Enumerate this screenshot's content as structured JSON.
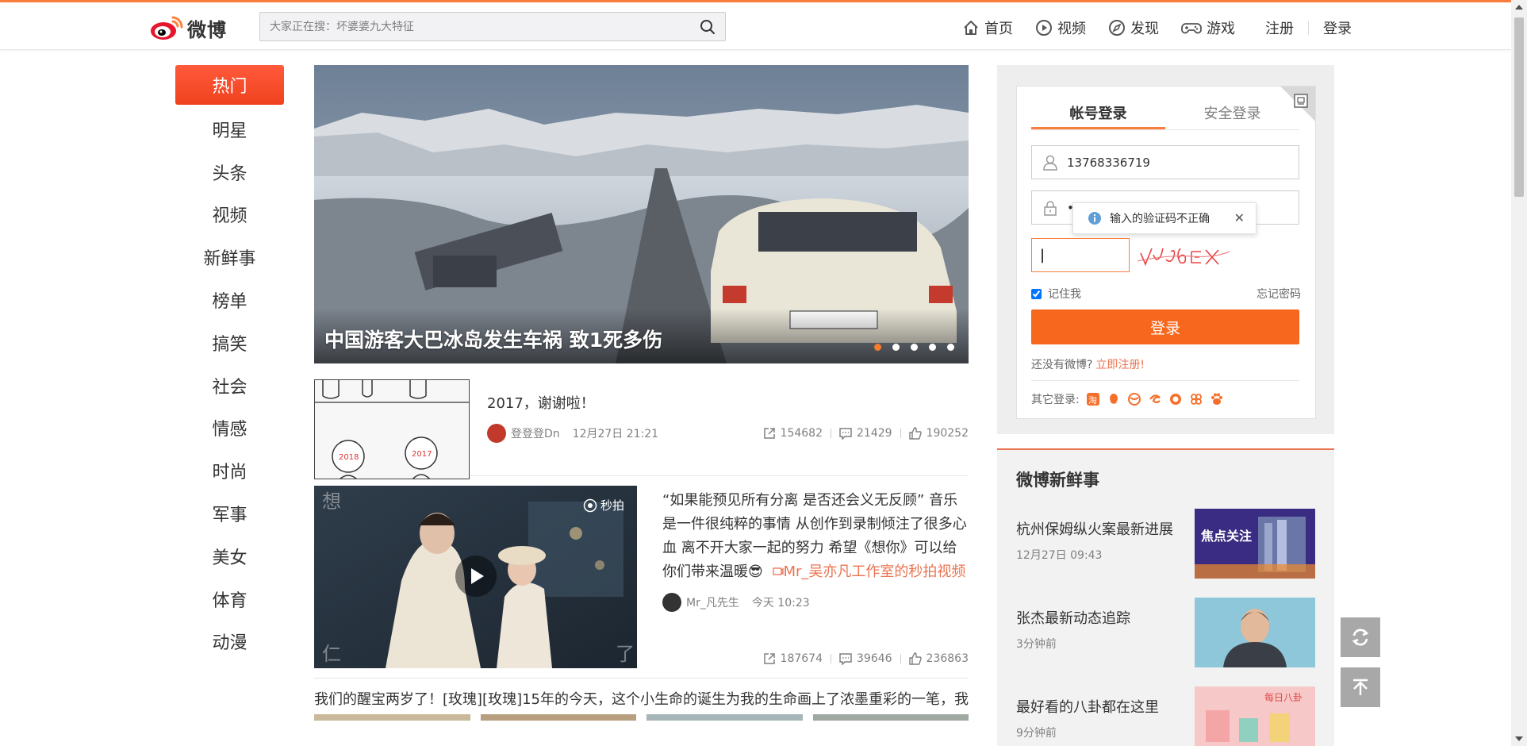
{
  "brand": {
    "name": "微博",
    "accent": "#fa7d3c",
    "link_color": "#eb7350"
  },
  "search": {
    "placeholder": "大家正在搜：坏婆婆九大特征"
  },
  "nav": {
    "home": "首页",
    "video": "视频",
    "discover": "发现",
    "game": "游戏",
    "register": "注册",
    "login": "登录"
  },
  "leftnav": {
    "items": [
      "热门",
      "明星",
      "头条",
      "视频",
      "新鲜事",
      "榜单",
      "搞笑",
      "社会",
      "情感",
      "时尚",
      "军事",
      "美女",
      "体育",
      "动漫"
    ]
  },
  "hero": {
    "title": "中国游客大巴冰岛发生车祸 致1死多伤",
    "slides": 5,
    "active_slide": 1
  },
  "feed": [
    {
      "text": "2017，谢谢啦！",
      "author": "登登登Dn",
      "time": "12月27日 21:21",
      "reposts": "154682",
      "comments": "21429",
      "likes": "190252"
    },
    {
      "text": "“如果能预见所有分离  是否还会义无反顾”  音乐是一件很纯粹的事情  从创作到录制倾注了很多心血  离不开大家一起的努力 希望《想你》可以给你们带来温暖😎",
      "link": "Mr_吴亦凡工作室的秒拍视频",
      "badge": "秒拍",
      "author": "Mr_凡先生",
      "time": "今天 10:23",
      "reposts": "187674",
      "comments": "39646",
      "likes": "236863"
    },
    {
      "text": "我们的醒宝两岁了！[玫瑰][玫瑰]15年的今天，这个小生命的诞生为我的生命画上了浓墨重彩的一笔，我知道"
    }
  ],
  "login": {
    "tab_account": "帐号登录",
    "tab_secure": "安全登录",
    "username": "13768336719",
    "password": "••••••",
    "error_tip": "输入的验证码不正确",
    "captcha_value": "|",
    "remember": "记住我",
    "forgot": "忘记密码",
    "button": "登录",
    "no_account": "还没有微博?",
    "register_now": "立即注册!",
    "other_login": "其它登录:"
  },
  "news": {
    "title": "微博新鲜事",
    "items": [
      {
        "title": "杭州保姆纵火案最新进展",
        "sub": "12月27日 09:43",
        "badge": "焦点关注"
      },
      {
        "title": "张杰最新动态追踪",
        "sub": "3分钟前"
      },
      {
        "title": "最好看的八卦都在这里",
        "sub": "9分钟前",
        "badge": "每日八卦"
      }
    ]
  }
}
